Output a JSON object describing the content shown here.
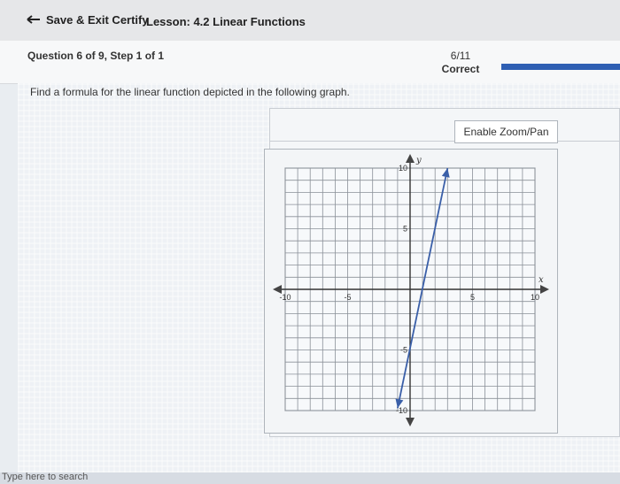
{
  "topbar": {
    "back_label": "Save & Exit Certify",
    "lesson_title": "Lesson: 4.2 Linear Functions"
  },
  "question": {
    "label": "Question 6 of 9, Step 1 of 1",
    "score": "6/11",
    "status": "Correct",
    "progress_fraction": 1.0,
    "prompt": "Find a formula for the linear function depicted in the following graph."
  },
  "graph_panel": {
    "zoom_button": "Enable Zoom/Pan"
  },
  "chart_data": {
    "type": "line",
    "xlabel": "x",
    "ylabel": "y",
    "xlim": [
      -10,
      10
    ],
    "ylim": [
      -10,
      10
    ],
    "grid": true,
    "x_tick_labels": [
      "-10",
      "-5",
      "5",
      "10"
    ],
    "y_tick_labels": [
      "10",
      "5",
      "-5",
      "-10"
    ],
    "series": [
      {
        "x": [
          -1,
          3
        ],
        "y": [
          -9.8,
          10
        ]
      }
    ]
  },
  "taskbar": {
    "search_placeholder": "Type here to search"
  },
  "colors": {
    "accent": "#2f5fb3",
    "line": "#3a5fa8"
  }
}
